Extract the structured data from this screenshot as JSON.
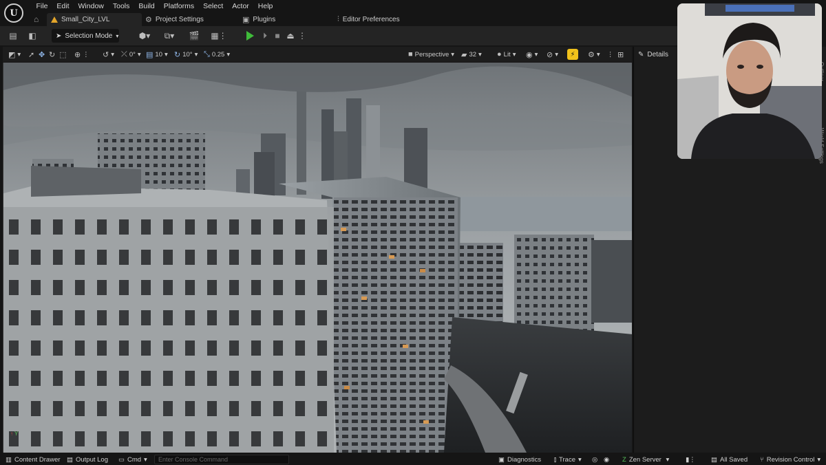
{
  "menu": {
    "items": [
      "File",
      "Edit",
      "Window",
      "Tools",
      "Build",
      "Platforms",
      "Select",
      "Actor",
      "Help"
    ]
  },
  "tabs": {
    "level": "Small_City_LVL",
    "project_settings": "Project Settings",
    "plugins": "Plugins",
    "editor_preferences": "Editor Preferences"
  },
  "toolbar": {
    "selection_mode": "Selection Mode"
  },
  "viewport_toolbar": {
    "rotation_snap": "0°",
    "grid_size": "10",
    "angle_snap": "10°",
    "scale_snap": "0.25",
    "view_mode": "Perspective",
    "camera_speed": "32",
    "lit_mode": "Lit"
  },
  "details": {
    "title": "Details",
    "side_tab_outliner": "Outliner",
    "side_tab_world": "World Settings"
  },
  "statusbar": {
    "content_drawer": "Content Drawer",
    "output_log": "Output Log",
    "cmd": "Cmd",
    "console_placeholder": "Enter Console Command",
    "diagnostics": "Diagnostics",
    "trace": "Trace",
    "zen_server": "Zen Server",
    "all_saved": "All Saved",
    "revision_control": "Revision Control"
  },
  "colors": {
    "play": "#3fbb3a",
    "snap_active": "#f1c21b",
    "level_icon": "#e3a52a"
  }
}
